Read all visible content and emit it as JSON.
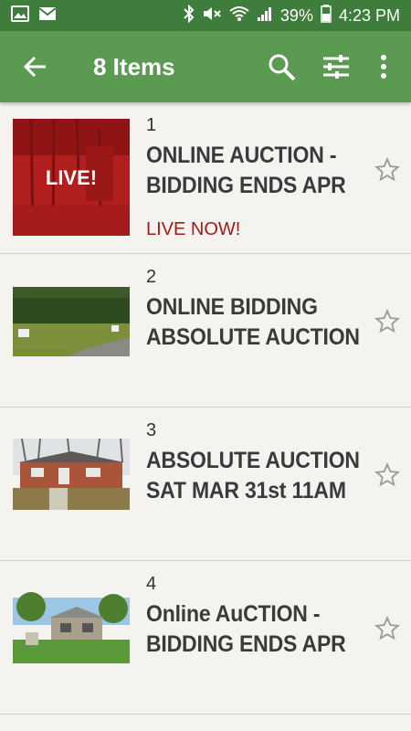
{
  "status_bar": {
    "battery_percent": "39%",
    "time": "4:23 PM"
  },
  "toolbar": {
    "title": "8 Items"
  },
  "items": [
    {
      "number": "1",
      "title_line1": "ONLINE AUCTION -",
      "title_line2": "BIDDING ENDS APR",
      "badge": "LIVE NOW!",
      "thumb_overlay": "LIVE!"
    },
    {
      "number": "2",
      "title_line1": "ONLINE BIDDING",
      "title_line2": "ABSOLUTE AUCTION"
    },
    {
      "number": "3",
      "title_line1": "ABSOLUTE AUCTION",
      "title_line2": "SAT MAR 31st 11AM"
    },
    {
      "number": "4",
      "title_line1": "Online AuCTION -",
      "title_line2": "BIDDING ENDS APR"
    }
  ],
  "colors": {
    "status_bar": "#3f7d3c",
    "toolbar": "#5a9a51",
    "background": "#f4f3ef",
    "live_red": "#a01c1c"
  }
}
